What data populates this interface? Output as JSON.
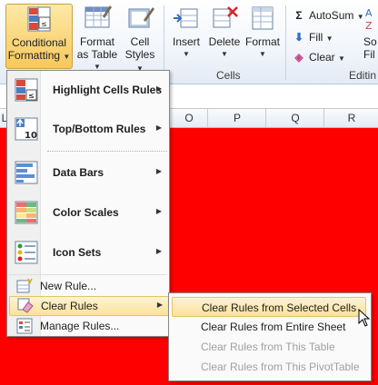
{
  "ribbon": {
    "conditional_formatting": {
      "line1": "Conditional",
      "line2": "Formatting"
    },
    "format_as_table": {
      "line1": "Format",
      "line2": "as Table"
    },
    "cell_styles": {
      "line1": "Cell",
      "line2": "Styles"
    },
    "insert": "Insert",
    "delete": "Delete",
    "format": "Format",
    "cells_group": "Cells",
    "autosum": "AutoSum",
    "fill": "Fill",
    "clear": "Clear",
    "editing_group": "Editin",
    "sort_partial": "So",
    "sort_partial2": "Fil",
    "sigma": "Σ"
  },
  "columns": [
    "L",
    "O",
    "P",
    "Q",
    "R"
  ],
  "menu": {
    "items": [
      {
        "label": "Highlight Cells Rules",
        "icon": "highlight-cells-icon"
      },
      {
        "label": "Top/Bottom Rules",
        "icon": "top-bottom-icon",
        "icon_text": "10"
      },
      {
        "label": "Data Bars",
        "icon": "data-bars-icon"
      },
      {
        "label": "Color Scales",
        "icon": "color-scales-icon"
      },
      {
        "label": "Icon Sets",
        "icon": "icon-sets-icon"
      }
    ],
    "small_items": [
      {
        "label": "New Rule...",
        "icon": "new-rule-icon"
      },
      {
        "label": "Clear Rules",
        "icon": "clear-rules-icon"
      },
      {
        "label": "Manage Rules...",
        "icon": "manage-rules-icon"
      }
    ]
  },
  "submenu": {
    "items": [
      {
        "label": "Clear Rules from Selected Cells",
        "enabled": true,
        "highlighted": true
      },
      {
        "label": "Clear Rules from Entire Sheet",
        "enabled": true,
        "highlighted": false
      },
      {
        "label": "Clear Rules from This Table",
        "enabled": false,
        "highlighted": false
      },
      {
        "label": "Clear Rules from This PivotTable",
        "enabled": false,
        "highlighted": false
      }
    ]
  },
  "colors": {
    "sheet_fill": "#ff0000",
    "highlight": "#fbe29b",
    "disabled_text": "#a0a0a0"
  }
}
